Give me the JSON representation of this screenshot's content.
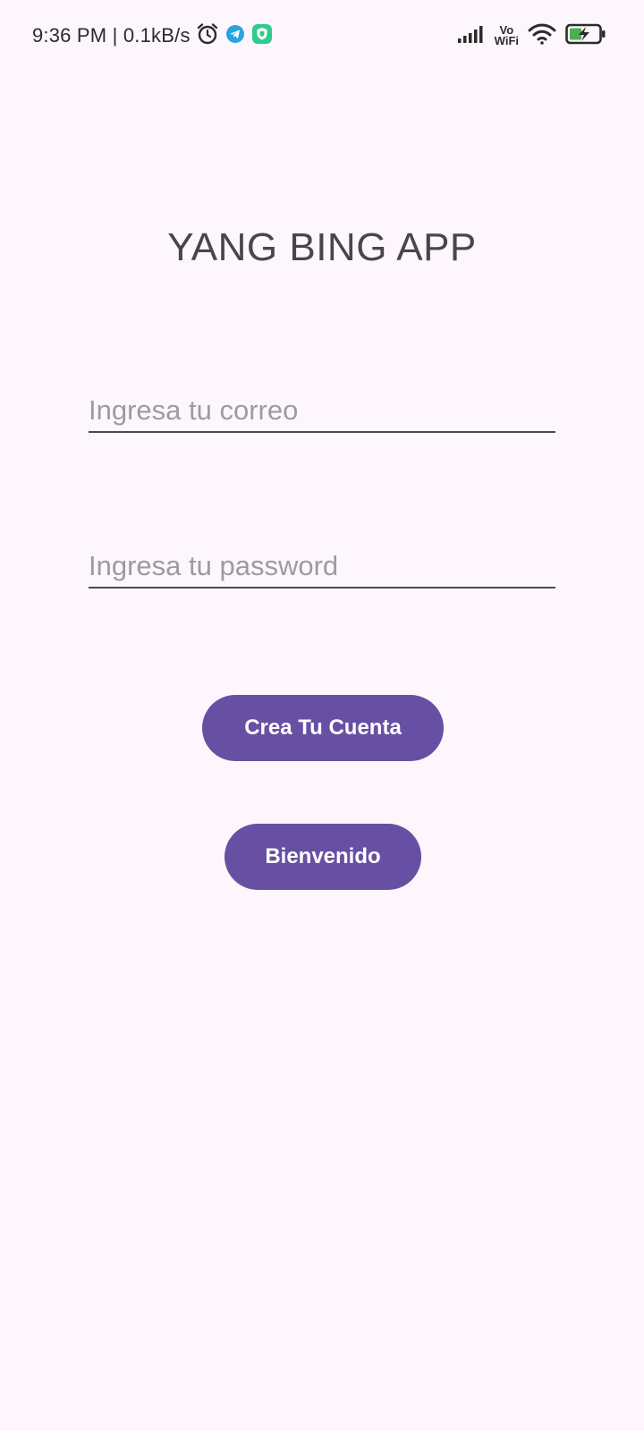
{
  "status_bar": {
    "time_text": "9:36 PM | 0.1kB/s",
    "vowifi_top": "Vo",
    "vowifi_bottom": "WiFi",
    "icons": [
      "alarm-icon",
      "telegram-icon",
      "shield-app-icon",
      "signal-icon",
      "wifi-icon",
      "battery-charging-icon"
    ]
  },
  "app": {
    "title": "YANG BING APP"
  },
  "form": {
    "email_placeholder": "Ingresa tu correo",
    "email_value": "",
    "password_placeholder": "Ingresa tu password",
    "password_value": ""
  },
  "buttons": {
    "create_account_label": "Crea Tu Cuenta",
    "welcome_label": "Bienvenido"
  },
  "colors": {
    "background": "#fdf7fd",
    "primary": "#6750a4",
    "title_text": "#49454f",
    "telegram": "#2aa3de",
    "shield_app": "#2ecc8f",
    "battery_charge": "#4caf50"
  }
}
